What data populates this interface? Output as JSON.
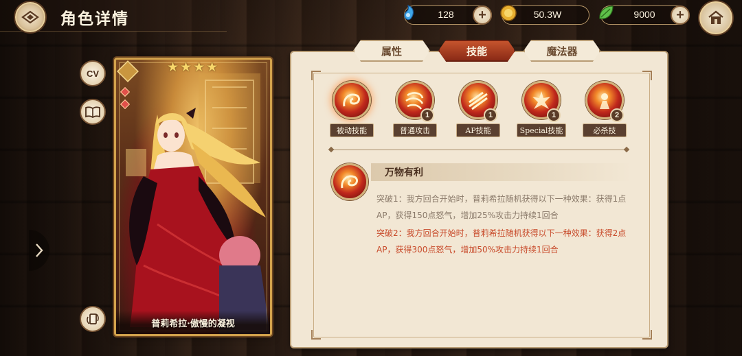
{
  "header": {
    "title": "角色详情"
  },
  "resources": [
    {
      "name": "blue-gem",
      "value": "128",
      "color": "#3fa6e8"
    },
    {
      "name": "gold-coin",
      "value": "50.3W",
      "color": "#e8b030"
    },
    {
      "name": "green-leaf",
      "value": "9000",
      "color": "#5fc04a"
    }
  ],
  "side_buttons": {
    "cv_label": "CV"
  },
  "character": {
    "stars": 4,
    "name": "普莉希拉·傲慢的凝视"
  },
  "tabs": [
    {
      "label": "属性",
      "active": false
    },
    {
      "label": "技能",
      "active": true
    },
    {
      "label": "魔法器",
      "active": false
    }
  ],
  "skills": [
    {
      "label": "被动技能",
      "level": "",
      "selected": true
    },
    {
      "label": "普通攻击",
      "level": "1",
      "selected": false
    },
    {
      "label": "AP技能",
      "level": "1",
      "selected": false
    },
    {
      "label": "Special技能",
      "level": "1",
      "selected": false
    },
    {
      "label": "必杀技",
      "level": "2",
      "selected": false
    }
  ],
  "skill_detail": {
    "title": "万物有利",
    "breakthrough_1": "突破1：我方回合开始时，普莉希拉随机获得以下一种效果：获得1点AP，获得150点怒气，增加25%攻击力持续1回合",
    "breakthrough_2": "突破2：我方回合开始时，普莉希拉随机获得以下一种效果：获得2点AP，获得300点怒气，增加50%攻击力持续1回合"
  }
}
